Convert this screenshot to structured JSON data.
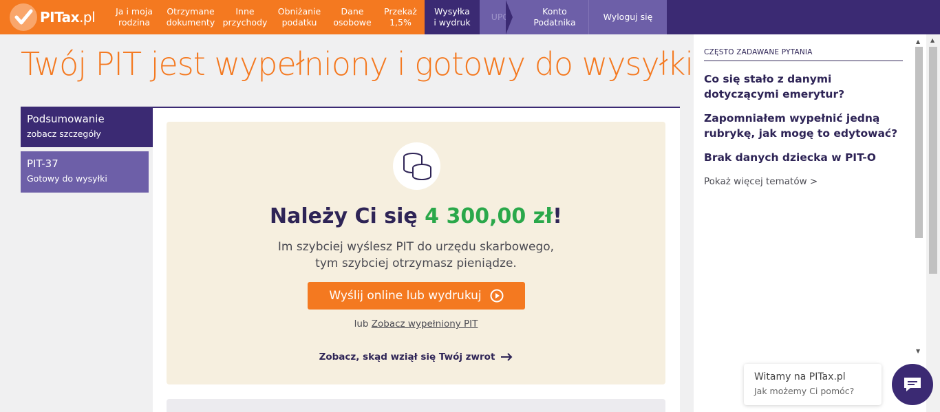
{
  "brand": {
    "logo_main": "PITax",
    "logo_suffix": ".pl"
  },
  "nav": {
    "items": [
      {
        "label": "Ja i moja\nrodzina"
      },
      {
        "label": "Otrzymane\ndokumenty"
      },
      {
        "label": "Inne\nprzychody"
      },
      {
        "label": "Obniżanie\npodatku"
      },
      {
        "label": "Dane\nosobowe"
      },
      {
        "label": "Przekaż\n1,5%"
      },
      {
        "label": "Wysyłka\ni wydruk"
      },
      {
        "label": "UPO"
      }
    ],
    "account_label": "Konto\nPodatnika",
    "logout_label": "Wyloguj się"
  },
  "main": {
    "title": "Twój PIT jest wypełniony i gotowy do wysyłki",
    "sidebar": [
      {
        "title": "Podsumowanie",
        "subtitle": "zobacz szczegóły"
      },
      {
        "title": "PIT-37",
        "subtitle": "Gotowy do wysyłki"
      }
    ],
    "refund": {
      "heading_prefix": "Należy Ci się ",
      "amount": "4 300,00 zł",
      "heading_suffix": "!",
      "subtitle_line1": "Im szybciej wyślesz PIT do urzędu skarbowego,",
      "subtitle_line2": "tym szybciej otrzymasz pieniądze.",
      "send_button": "Wyślij online lub wydrukuj",
      "alt_prefix": "lub ",
      "alt_link": "Zobacz wypełniony PIT",
      "source_link": "Zobacz, skąd wziął się Twój zwrot"
    }
  },
  "faq": {
    "heading": "CZĘSTO ZADAWANE PYTANIA",
    "questions": [
      "Co się stało z danymi dotyczącymi emerytur?",
      "Zapomniałem wypełnić jedną rubrykę, jak mogę to edytować?",
      "Brak danych dziecka w PIT-O"
    ],
    "more": "Pokaż więcej tematów >"
  },
  "chat": {
    "greeting": "Witamy na PITax.pl",
    "prompt": "Jak możemy Ci pomóc?"
  },
  "colors": {
    "orange": "#f47920",
    "purple": "#3b2a73",
    "light_purple": "#6d5fa8",
    "green": "#2aa84a",
    "cream": "#f6efdf"
  }
}
